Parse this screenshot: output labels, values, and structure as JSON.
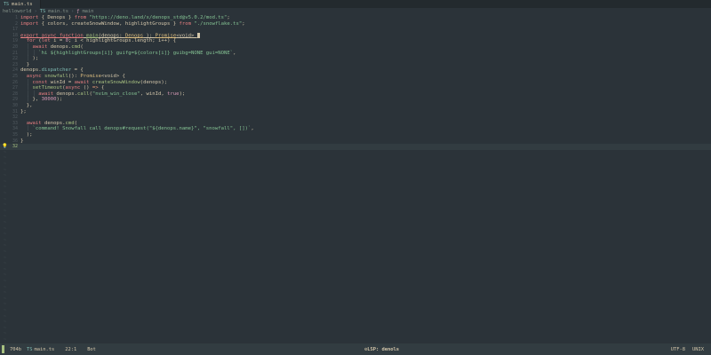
{
  "tabline": {
    "icon": "typescript-file-icon",
    "tab_label": "main.ts"
  },
  "winbar": {
    "project": "helloworld",
    "file": "main.ts",
    "symbol": "main",
    "sep": "›"
  },
  "editor": {
    "lines": [
      {
        "n": "1",
        "sign": "",
        "tokens": [
          [
            "kw",
            "import"
          ],
          [
            "p",
            " { Denops } "
          ],
          [
            "kw",
            "from"
          ],
          [
            "str",
            " \"https://deno.land/x/denops_std@v5.0.2/mod.ts\""
          ],
          [
            "p",
            ";"
          ]
        ]
      },
      {
        "n": "2",
        "sign": "",
        "tokens": [
          [
            "kw",
            "import"
          ],
          [
            "p",
            " { colors, createSnowWindow, highlightGroups } "
          ],
          [
            "kw",
            "from"
          ],
          [
            "str",
            " \"./snowflake.ts\""
          ],
          [
            "p",
            ";"
          ]
        ]
      },
      {
        "n": "17",
        "sign": "",
        "tokens": []
      },
      {
        "n": "18",
        "sign": "",
        "tokens": [
          [
            "kw u",
            "export async function"
          ],
          [
            "p u",
            " "
          ],
          [
            "fn u",
            "main"
          ],
          [
            "p u",
            "(denops: "
          ],
          [
            "ty u",
            "Denops"
          ],
          [
            "p u",
            " ): "
          ],
          [
            "ty u",
            "Promise"
          ],
          [
            "p u",
            "<void> "
          ],
          [
            "cursor",
            ""
          ]
        ]
      },
      {
        "n": "19",
        "sign": "",
        "tokens": [
          [
            "ind",
            "  "
          ],
          [
            "kw",
            "for"
          ],
          [
            "p",
            " ("
          ],
          [
            "kw",
            "let"
          ],
          [
            "p",
            " i = "
          ],
          [
            "num",
            "0"
          ],
          [
            "p",
            "; i < highlightGroups.length; i++) {"
          ]
        ]
      },
      {
        "n": "20",
        "sign": "",
        "tokens": [
          [
            "ind",
            "  │ "
          ],
          [
            "kw",
            "await"
          ],
          [
            "p",
            " denops."
          ],
          [
            "fn",
            "cmd"
          ],
          [
            "p",
            "("
          ]
        ]
      },
      {
        "n": "21",
        "sign": "",
        "tokens": [
          [
            "ind",
            "  │ │ "
          ],
          [
            "str",
            "`hi ${highlightGroups[i]} guifg=${colors[i]} guibg=NONE gui=NONE`"
          ],
          [
            "p",
            ","
          ]
        ]
      },
      {
        "n": "22",
        "sign": "",
        "tokens": [
          [
            "ind",
            "  │ "
          ],
          [
            "p",
            ");"
          ]
        ]
      },
      {
        "n": "23",
        "sign": "",
        "tokens": [
          [
            "ind",
            "  "
          ],
          [
            "p",
            "}"
          ]
        ]
      },
      {
        "n": "24",
        "sign": "",
        "tokens": [
          [
            "p",
            "denops."
          ],
          [
            "id",
            "dispatcher"
          ],
          [
            "p",
            " = {"
          ]
        ]
      },
      {
        "n": "25",
        "sign": "",
        "tokens": [
          [
            "ind",
            "  "
          ],
          [
            "kw",
            "async"
          ],
          [
            "p",
            " "
          ],
          [
            "fn",
            "snowfall"
          ],
          [
            "p",
            "(): "
          ],
          [
            "ty",
            "Promise"
          ],
          [
            "p",
            "<void> {"
          ]
        ]
      },
      {
        "n": "26",
        "sign": "",
        "tokens": [
          [
            "ind",
            "  │ "
          ],
          [
            "kw",
            "const"
          ],
          [
            "p",
            " winId = "
          ],
          [
            "kw",
            "await"
          ],
          [
            "p",
            " "
          ],
          [
            "fn",
            "createSnowWindow"
          ],
          [
            "p",
            "(denops);"
          ]
        ]
      },
      {
        "n": "27",
        "sign": "",
        "tokens": [
          [
            "ind",
            "  │ "
          ],
          [
            "fn",
            "setTimeout"
          ],
          [
            "p",
            "("
          ],
          [
            "kw",
            "async"
          ],
          [
            "p",
            " () "
          ],
          [
            "op",
            "=>"
          ],
          [
            "p",
            " {"
          ]
        ]
      },
      {
        "n": "28",
        "sign": "",
        "tokens": [
          [
            "ind",
            "  │ │ "
          ],
          [
            "kw",
            "await"
          ],
          [
            "p",
            " denops."
          ],
          [
            "fn",
            "call"
          ],
          [
            "p",
            "("
          ],
          [
            "str",
            "\"nvim_win_close\""
          ],
          [
            "p",
            ", winId, "
          ],
          [
            "num",
            "true"
          ],
          [
            "p",
            ");"
          ]
        ]
      },
      {
        "n": "29",
        "sign": "",
        "tokens": [
          [
            "ind",
            "  │ "
          ],
          [
            "p",
            "}, "
          ],
          [
            "num",
            "30000"
          ],
          [
            "p",
            ");"
          ]
        ]
      },
      {
        "n": "30",
        "sign": "",
        "tokens": [
          [
            "ind",
            "  "
          ],
          [
            "p",
            "},"
          ]
        ]
      },
      {
        "n": "31",
        "sign": "",
        "tokens": [
          [
            "p",
            "};"
          ]
        ]
      },
      {
        "n": "32",
        "sign": "",
        "tokens": []
      },
      {
        "n": "33",
        "sign": "",
        "tokens": [
          [
            "ind",
            "  "
          ],
          [
            "kw",
            "await"
          ],
          [
            "p",
            " denops."
          ],
          [
            "fn",
            "cmd"
          ],
          [
            "p",
            "("
          ]
        ]
      },
      {
        "n": "34",
        "sign": "",
        "tokens": [
          [
            "ind",
            "  │ "
          ],
          [
            "str",
            "`command! Snowfall call denops#request(\"${denops.name}\", \"snowfall\", [])`"
          ],
          [
            "p",
            ","
          ]
        ]
      },
      {
        "n": "35",
        "sign": "",
        "tokens": [
          [
            "ind",
            "  "
          ],
          [
            "p",
            ");"
          ]
        ]
      },
      {
        "n": "36",
        "sign": "",
        "tokens": [
          [
            "p",
            "}"
          ]
        ]
      },
      {
        "n": "32",
        "sign": "💡",
        "tokens": [],
        "current": true
      }
    ],
    "empty_marker": "~"
  },
  "statusline": {
    "size": "704b",
    "filename": "main.ts",
    "position": "22:1",
    "percent": "Bot",
    "lsp": "LSP: denols",
    "encoding": "UTF-8",
    "fileformat": "UNIX",
    "accent_color": "#a7c080"
  }
}
